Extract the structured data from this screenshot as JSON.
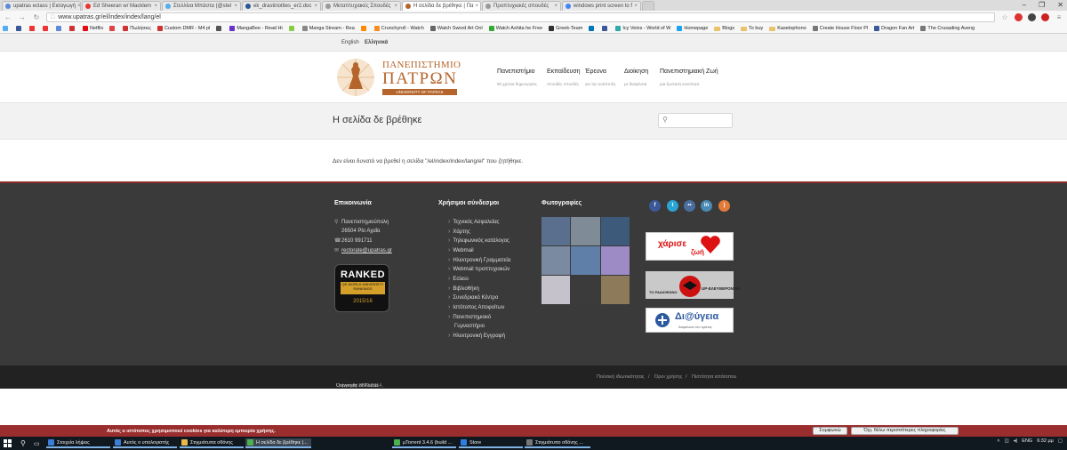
{
  "browser": {
    "tabs": [
      {
        "label": "upatras eclass | Εισαγωγή",
        "color": "#5b8bd9"
      },
      {
        "label": "Ed Sheeran w/ Macklem",
        "color": "#e33"
      },
      {
        "label": "Στελλίνα Μπάστα (@stel",
        "color": "#55acee"
      },
      {
        "label": "ek_drastiriotites_er2.doc",
        "color": "#2b5797"
      },
      {
        "label": "Μεταπτυχιακές Σπουδές",
        "color": "#999"
      },
      {
        "label": "Η σελίδα δε βρέθηκε | Πα",
        "color": "#b5652c"
      },
      {
        "label": "Προπτυχιακές σπουδές",
        "color": "#999"
      },
      {
        "label": "windows print screen to f",
        "color": "#4285f4"
      }
    ],
    "active_tab": 5,
    "url": "www.upatras.gr/el/index/index/lang/el",
    "bookmarks": [
      {
        "label": "",
        "color": "#55acee"
      },
      {
        "label": "",
        "color": "#3b5998"
      },
      {
        "label": "",
        "color": "#e33"
      },
      {
        "label": "",
        "color": "#e33"
      },
      {
        "label": "",
        "color": "#5b8bd9"
      },
      {
        "label": "",
        "color": "#c33"
      },
      {
        "label": "Netflix",
        "color": "#e50914"
      },
      {
        "label": "",
        "color": "#d44"
      },
      {
        "label": "Πωλήσεις",
        "color": "#c33"
      },
      {
        "label": "Custom DMR - M4 pl",
        "color": "#c33"
      },
      {
        "label": "",
        "color": "#555"
      },
      {
        "label": "MangaBee - Read Hi",
        "color": "#63c"
      },
      {
        "label": "",
        "color": "#8c4"
      },
      {
        "label": "Manga Stream - Rea",
        "color": "#888"
      },
      {
        "label": "",
        "color": "#f80"
      },
      {
        "label": "Crunchyroll - Watch",
        "color": "#f78b24"
      },
      {
        "label": "Watch Sword Art Onl",
        "color": "#666"
      },
      {
        "label": "Watch Ashita he Free",
        "color": "#3a3"
      },
      {
        "label": "Greek-Team",
        "color": "#333"
      },
      {
        "label": "",
        "color": "#0077b5"
      },
      {
        "label": "",
        "color": "#3b5998"
      },
      {
        "label": "Icy Veins - World of W",
        "color": "#3aa"
      },
      {
        "label": "Homepage",
        "color": "#1da1f2"
      },
      {
        "label": "Blogs",
        "folder": true
      },
      {
        "label": "To buy",
        "folder": true
      },
      {
        "label": "Kasetophono",
        "folder": true
      },
      {
        "label": "Create House Floor Pl",
        "color": "#777"
      },
      {
        "label": "Dragon Fan Art",
        "color": "#3b5998"
      },
      {
        "label": "The Crusading Aveng",
        "color": "#777"
      }
    ]
  },
  "site": {
    "lang": {
      "english": "English",
      "greek": "Ελληνικά"
    },
    "logo": {
      "line1": "ΠΑΝΕΠΙΣΤΗΜΙΟ",
      "line2": "ΠΑΤΡΩΝ",
      "line3": "UNIVERSITY OF PATRAS"
    },
    "menu": [
      {
        "label": "Πανεπιστήμιο",
        "sub": "60 χρόνια δημιουργίας"
      },
      {
        "label": "Εκπαίδευση",
        "sub": "σπουδές σπουδές"
      },
      {
        "label": "Έρευνα",
        "sub": "για την ανάπτυξη"
      },
      {
        "label": "Διοίκηση",
        "sub": "με διαφάνεια"
      },
      {
        "label": "Πανεπιστημιακή Ζωή",
        "sub": "μια ζωντανή κοινότητα"
      }
    ],
    "page_title": "Η σελίδα δε βρέθηκε",
    "search_placeholder": "",
    "message": "Δεν είναι δυνατό να βρεθεί η σελίδα \"/el/index/index/lang/el\" που ζητήθηκε.",
    "footer": {
      "contact_heading": "Επικοινωνία",
      "address1": "Πανεπιστημιούπολη",
      "address2": "26504 Ρίο Αχαΐα",
      "phone": "2610 991711",
      "email": "rectorate@upatras.gr",
      "ranked": {
        "big": "RANKED",
        "small": "QS WORLD UNIVERSITY RANKINGS",
        "year": "2015/16"
      },
      "links_heading": "Χρήσιμοι σύνδεσμοι",
      "links": [
        "Τεχνικός Ασφαλείας",
        "Χάρτης",
        "Τηλεφωνικός κατάλογος",
        "Webmail",
        "Ηλεκτρονική Γραμματεία",
        "Webmail προπτυχιακών",
        "Eclass",
        "Βιβλιοθήκη",
        "Συνεδριακό Κέντρο",
        "Ιστότοπος Αποφοίτων",
        "Πανεπιστημιακό",
        "Γυμναστήριο",
        "Ηλεκτρονική Εγγραφή"
      ],
      "photos_heading": "Φωτογραφίες",
      "photo_colors": [
        "#5a6f8e",
        "#7f8b96",
        "#3d5a7a",
        "#7a8aa0",
        "#5f7fa8",
        "#9c8bc4",
        "#c6c2cc",
        "#3b3b3b",
        "#8c7a5a",
        "#9a8ab8",
        "#6e7e6a",
        "#4e4e6e"
      ],
      "social": [
        {
          "name": "facebook-icon",
          "glyph": "f",
          "color": "#3b5998"
        },
        {
          "name": "twitter-icon",
          "glyph": "t",
          "color": "#2aa4d5"
        },
        {
          "name": "flickr-icon",
          "glyph": "••",
          "color": "#4a6ea0"
        },
        {
          "name": "linkedin-icon",
          "glyph": "in",
          "color": "#4a8ab5"
        },
        {
          "name": "rss-icon",
          "glyph": ")",
          "color": "#e07b39"
        }
      ],
      "banner1": {
        "line1": "χάρισε",
        "line2": "ζωή"
      },
      "banner2": {
        "line1": "ΤΟ ΡΑΔΙΟΦΩΝΟ",
        "line2": "UP-ΕΛΕΥΘΕΡΟΝΤΑΙ"
      },
      "banner3": {
        "line1": "Δι@ύγεια",
        "line2": "διαφάνεια στο κράτος"
      },
      "copyright_left": "Copyright 2002-2014,",
      "copyright_org": "University of Patras",
      "copyright_links": [
        "Πολιτική ιδιωτικότητας",
        "Όροι χρήσης",
        "Πιστότητα ιστότοπου"
      ]
    }
  },
  "cookie": {
    "text": "Αυτός ο ιστότοπος χρησιμοποιεί cookies για καλύτερη εμπειρία χρήσης.",
    "accept": "Συμφωνώ",
    "more": "Όχι, θέλω περισσότερες πληροφορίες"
  },
  "taskbar": {
    "items": [
      {
        "label": "Στοιχεία λήψεις",
        "color": "#3b7dd8"
      },
      {
        "label": "Αυτός ο υπολογιστής",
        "color": "#3b7dd8"
      },
      {
        "label": "Στιγμιότυπα οθόνης",
        "color": "#e8b84a"
      },
      {
        "label": "Η σελίδα δε βρέθηκε |...",
        "color": "#4caf50"
      },
      {
        "label": "µTorrent 3.4.6 (build ...",
        "color": "#4caf50"
      },
      {
        "label": "Store",
        "color": "#2f7de1"
      },
      {
        "label": "Στιγμιότυπο οθόνης ...",
        "color": "#777"
      }
    ],
    "lang": "ENG",
    "time": "6:32 μμ"
  }
}
